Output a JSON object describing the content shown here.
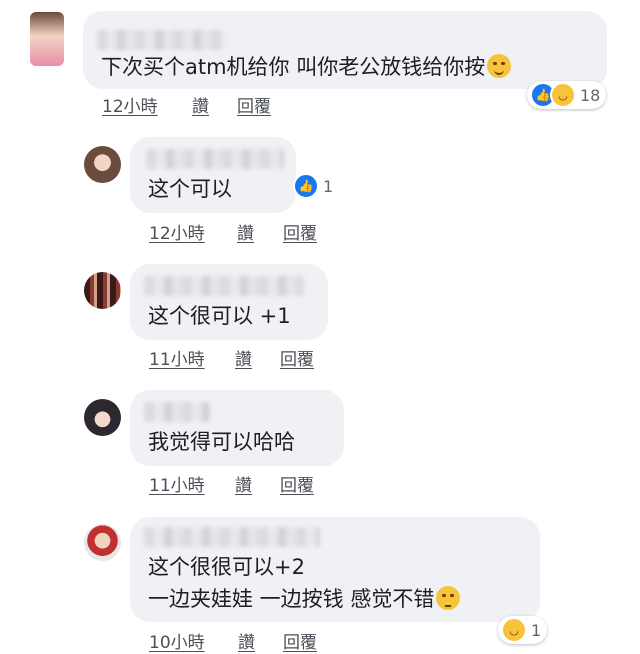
{
  "comments": [
    {
      "text": "下次买个atm机给你 叫你老公放钱给你按",
      "emoji": "smirk-emoji",
      "time": "12小時",
      "like": "讚",
      "reply": "回覆",
      "reaction_count": "18",
      "reactions": [
        "like-icon",
        "haha-icon"
      ],
      "avatar_color": "#e9a7b7"
    },
    {
      "text": "这个可以",
      "time": "12小時",
      "like": "讚",
      "reply": "回覆",
      "reaction_count": "1",
      "reactions": [
        "like-icon"
      ],
      "avatar_color": "#8a6a58"
    },
    {
      "text": "这个很可以 +1",
      "time": "11小時",
      "like": "讚",
      "reply": "回覆",
      "avatar_color": "#5a2d2a"
    },
    {
      "text": "我觉得可以哈哈",
      "time": "11小時",
      "like": "讚",
      "reply": "回覆",
      "avatar_color": "#3e3b44"
    },
    {
      "text_line1": "这个很很可以+2",
      "text_line2": "一边夹娃娃 一边按钱 感觉不错",
      "emoji": "thinking-emoji",
      "time": "10小時",
      "like": "讚",
      "reply": "回覆",
      "reaction_count": "1",
      "reactions": [
        "haha-icon"
      ],
      "avatar_color": "#6f9aa8"
    }
  ],
  "colors": {
    "bubble": "#f0f1f4",
    "like_blue": "#1877f2",
    "haha_yellow": "#f7c33b"
  }
}
